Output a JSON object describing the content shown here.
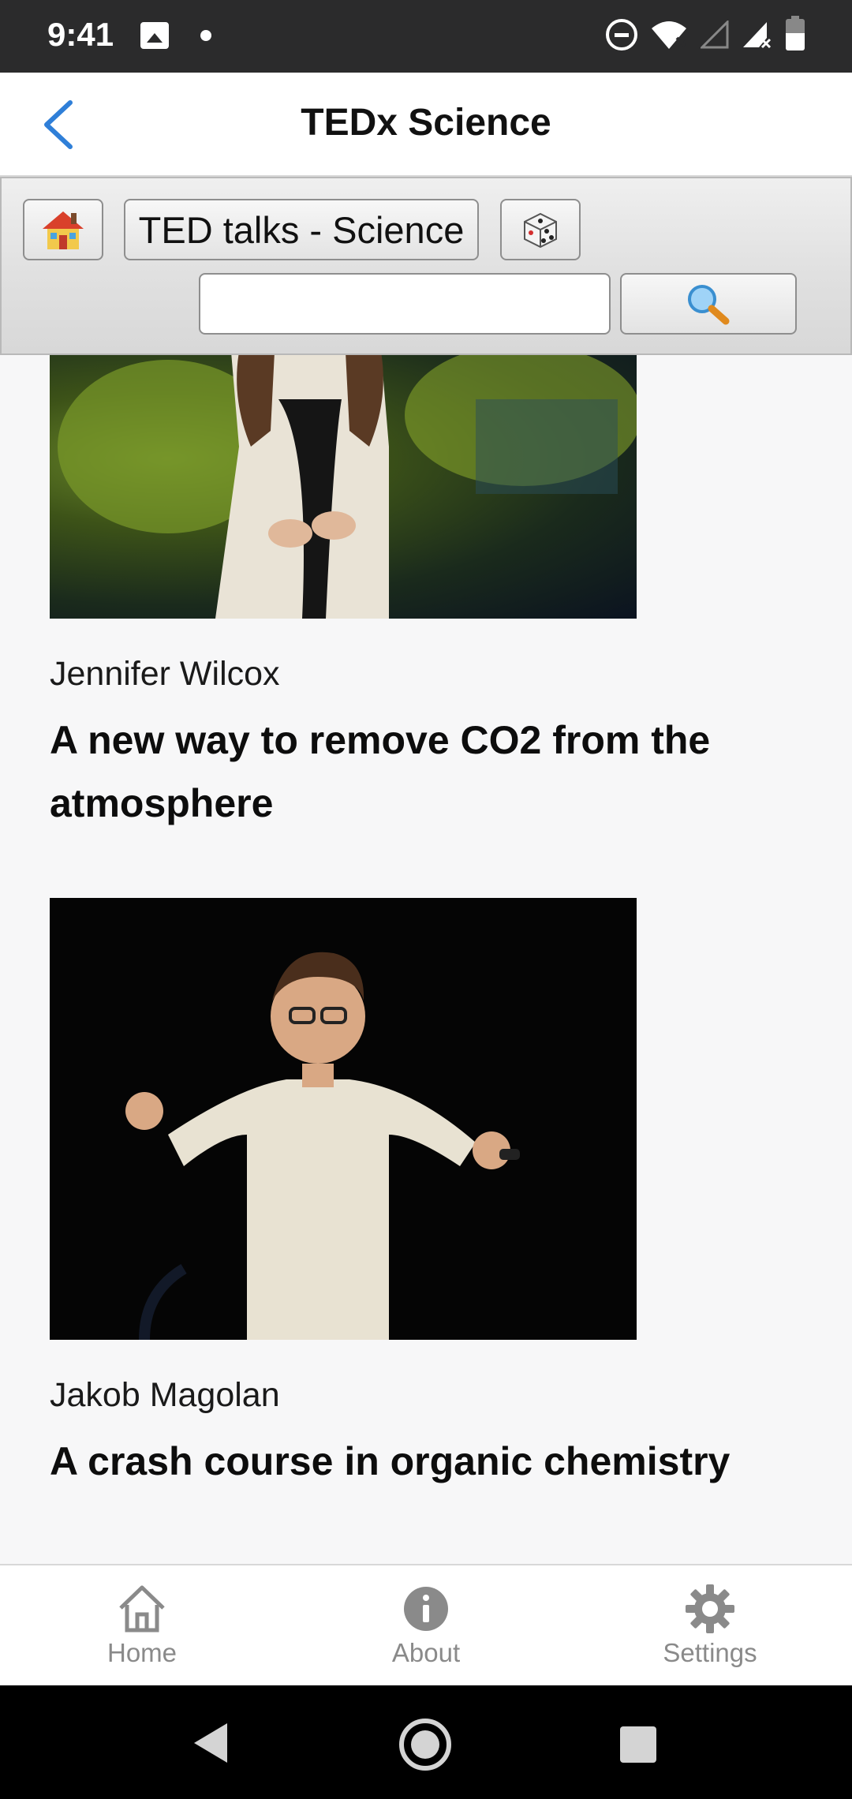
{
  "status_bar": {
    "time": "9:41",
    "icons": [
      "image-icon",
      "dot-icon",
      "dnd-icon",
      "wifi-icon",
      "signal-icon",
      "signal-icon",
      "battery-icon"
    ]
  },
  "header": {
    "title": "TEDx Science",
    "back_icon": "chevron-left-icon",
    "accent_color": "#2f7fd8"
  },
  "toolbar": {
    "home_icon": "house-icon",
    "category_label": "TED talks - Science",
    "random_icon": "dice-icon",
    "search_value": "",
    "search_icon": "magnifier-icon"
  },
  "feed": {
    "items": [
      {
        "speaker": "Jennifer Wilcox",
        "title": "A new way to remove CO2 from the atmosphere"
      },
      {
        "speaker": "Jakob Magolan",
        "title": "A crash course in organic chemistry"
      }
    ]
  },
  "tabs": [
    {
      "label": "Home",
      "icon": "home-icon"
    },
    {
      "label": "About",
      "icon": "info-icon"
    },
    {
      "label": "Settings",
      "icon": "gear-icon"
    }
  ],
  "nav_bar": {
    "icons": [
      "back-triangle-icon",
      "home-circle-icon",
      "recents-square-icon"
    ]
  }
}
